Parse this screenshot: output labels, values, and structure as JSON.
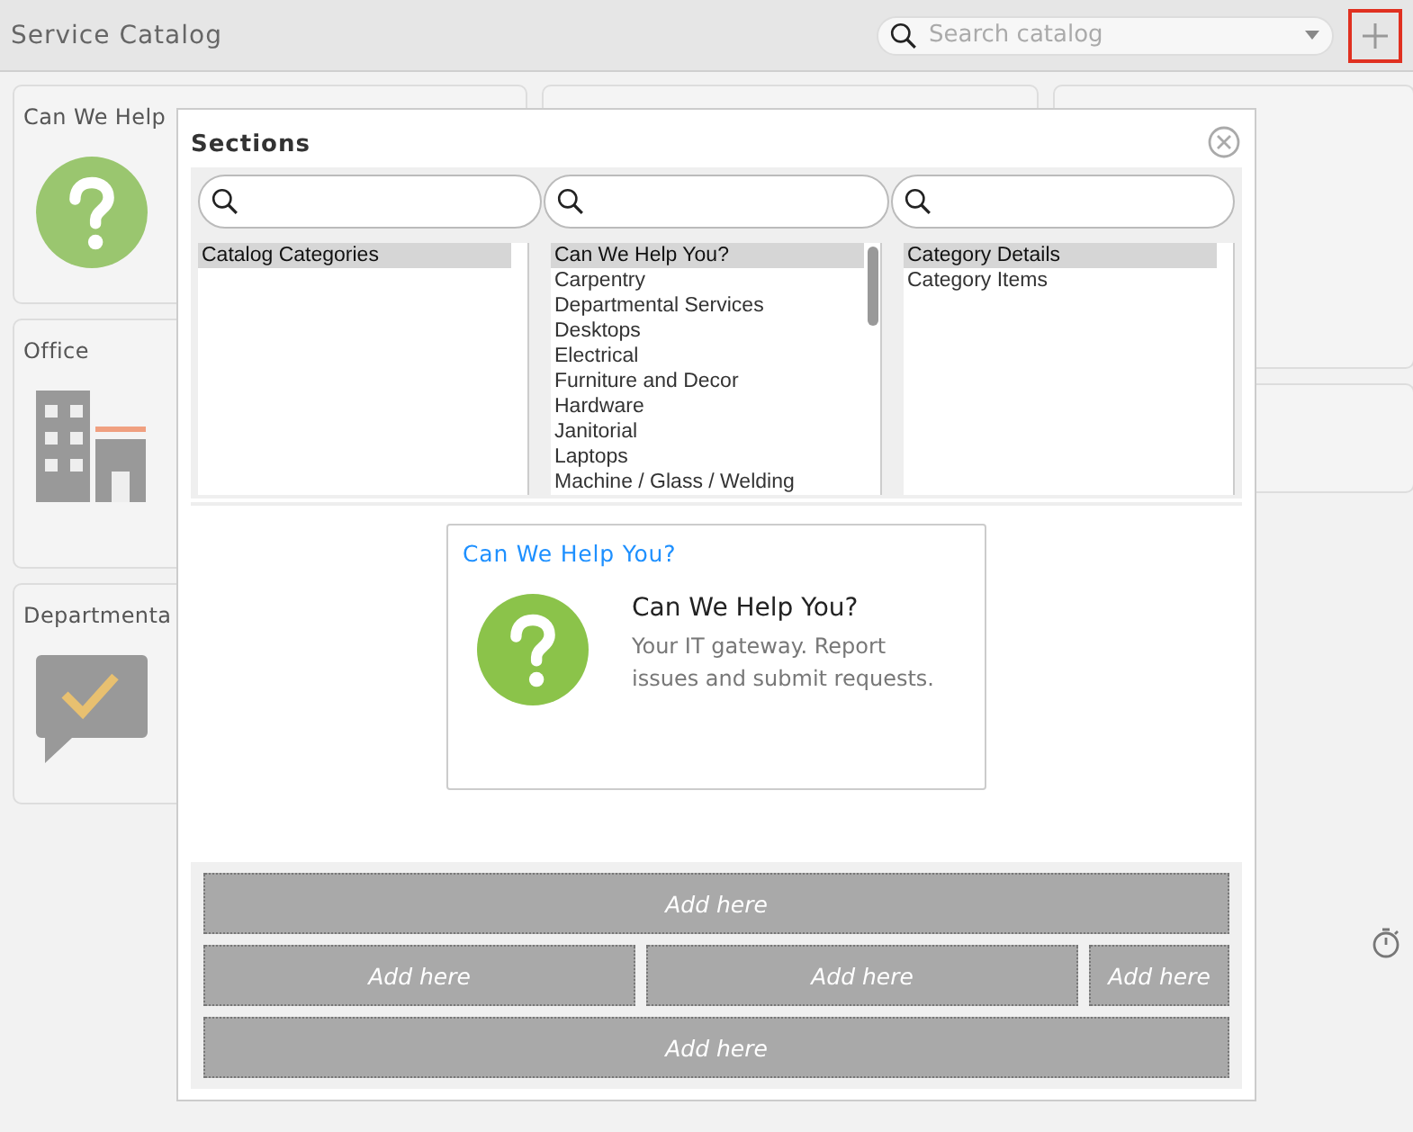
{
  "header": {
    "title": "Service Catalog",
    "search": {
      "placeholder": "Search catalog"
    }
  },
  "cards": [
    {
      "title": "Can We Help",
      "kind": "question"
    },
    {
      "title": "Office",
      "kind": "building"
    },
    {
      "title": "Departmenta",
      "kind": "chat"
    }
  ],
  "dialog": {
    "title": "Sections",
    "lists": [
      {
        "items": [
          {
            "label": "Catalog Categories",
            "selected": true
          }
        ]
      },
      {
        "items": [
          {
            "label": "Can We Help You?",
            "selected": true
          },
          {
            "label": "Carpentry",
            "selected": false
          },
          {
            "label": "Departmental Services",
            "selected": false
          },
          {
            "label": "Desktops",
            "selected": false
          },
          {
            "label": "Electrical",
            "selected": false
          },
          {
            "label": "Furniture and Decor",
            "selected": false
          },
          {
            "label": "Hardware",
            "selected": false
          },
          {
            "label": "Janitorial",
            "selected": false
          },
          {
            "label": "Laptops",
            "selected": false
          },
          {
            "label": "Machine / Glass / Welding",
            "selected": false
          }
        ]
      },
      {
        "items": [
          {
            "label": "Category Details",
            "selected": true
          },
          {
            "label": "Category Items",
            "selected": false
          }
        ]
      }
    ],
    "preview": {
      "header": "Can We Help You?",
      "title": "Can We Help You?",
      "description": "Your IT gateway. Report issues and submit requests."
    },
    "drop_rows": [
      [
        "Add here"
      ],
      [
        "Add here",
        "Add here",
        "Add here"
      ],
      [
        "Add here"
      ]
    ]
  }
}
